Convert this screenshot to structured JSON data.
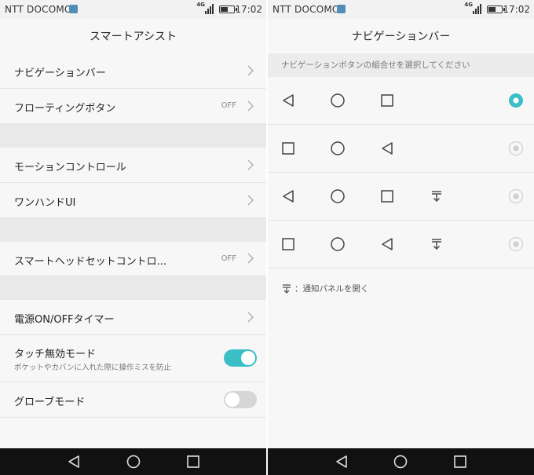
{
  "status": {
    "carrier": "NTT DOCOMO",
    "network": "4G",
    "time": "17:02",
    "battery_level": 0.6
  },
  "left": {
    "title": "スマートアシスト",
    "rows": [
      {
        "label": "ナビゲーションバー",
        "value": ""
      },
      {
        "label": "フローティングボタン",
        "value": "OFF"
      },
      {
        "label": "モーションコントロール",
        "value": ""
      },
      {
        "label": "ワンハンドUI",
        "value": ""
      },
      {
        "label": "スマートヘッドセットコントロ...",
        "value": "OFF"
      },
      {
        "label": "電源ON/OFFタイマー",
        "value": ""
      },
      {
        "label": "タッチ無効モード",
        "sub": "ポケットやカバンに入れた際に操作ミスを防止",
        "toggle": true
      },
      {
        "label": "グローブモード",
        "toggle": false
      }
    ]
  },
  "right": {
    "title": "ナビゲーションバー",
    "hint": "ナビゲーションボタンの組合せを選択してください",
    "options": [
      {
        "icons": [
          "back-icon",
          "home-icon",
          "recent-icon"
        ],
        "selected": true
      },
      {
        "icons": [
          "recent-icon",
          "home-icon",
          "back-icon"
        ],
        "selected": false
      },
      {
        "icons": [
          "back-icon",
          "home-icon",
          "recent-icon",
          "notification-icon"
        ],
        "selected": false
      },
      {
        "icons": [
          "recent-icon",
          "home-icon",
          "back-icon",
          "notification-icon"
        ],
        "selected": false
      }
    ],
    "legend": "：通知パネルを開く"
  },
  "colors": {
    "accent": "#3bbfc6",
    "toggle_off": "#d6d6d6",
    "navbar": "#111111"
  }
}
